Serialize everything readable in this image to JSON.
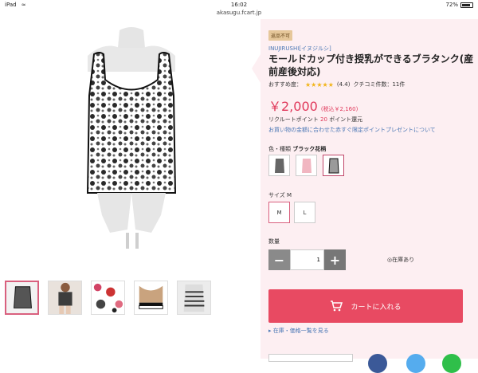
{
  "statusbar": {
    "time": "16:02",
    "battery": "72%"
  },
  "url": "akasugu.fcart.jp",
  "badge": "返品不可",
  "brand": "INUJIRUSHI[イヌジルシ]",
  "title": "モールドカップ付き授乳ができるブラタンク(産前産後対応)",
  "rating": {
    "label": "おすすめ度：",
    "stars": "★★★★★",
    "score": "(4.4)",
    "reviews": "クチコミ件数：11件"
  },
  "price": {
    "main": "￥2,000",
    "tax": "(税込￥2,160)"
  },
  "points": {
    "prefix": "リクルートポイント",
    "value": "20",
    "suffix": "ポイント還元"
  },
  "points_link": "お買い物の金額に合わせた赤すぐ限定ポイントプレゼントについて",
  "color": {
    "label": "色・種類",
    "selected": "ブラック花柄"
  },
  "size": {
    "label": "サイズ",
    "selected": "M",
    "options": [
      "M",
      "L"
    ]
  },
  "quantity": {
    "label": "数量",
    "value": "1"
  },
  "stock": "◎在庫あり",
  "cart_button": "カートに入れる",
  "stock_link": "▸ 在庫・価格一覧を見る",
  "colors": {
    "accent": "#e84a62",
    "panel": "#fdeff2",
    "link": "#4a77b5"
  }
}
